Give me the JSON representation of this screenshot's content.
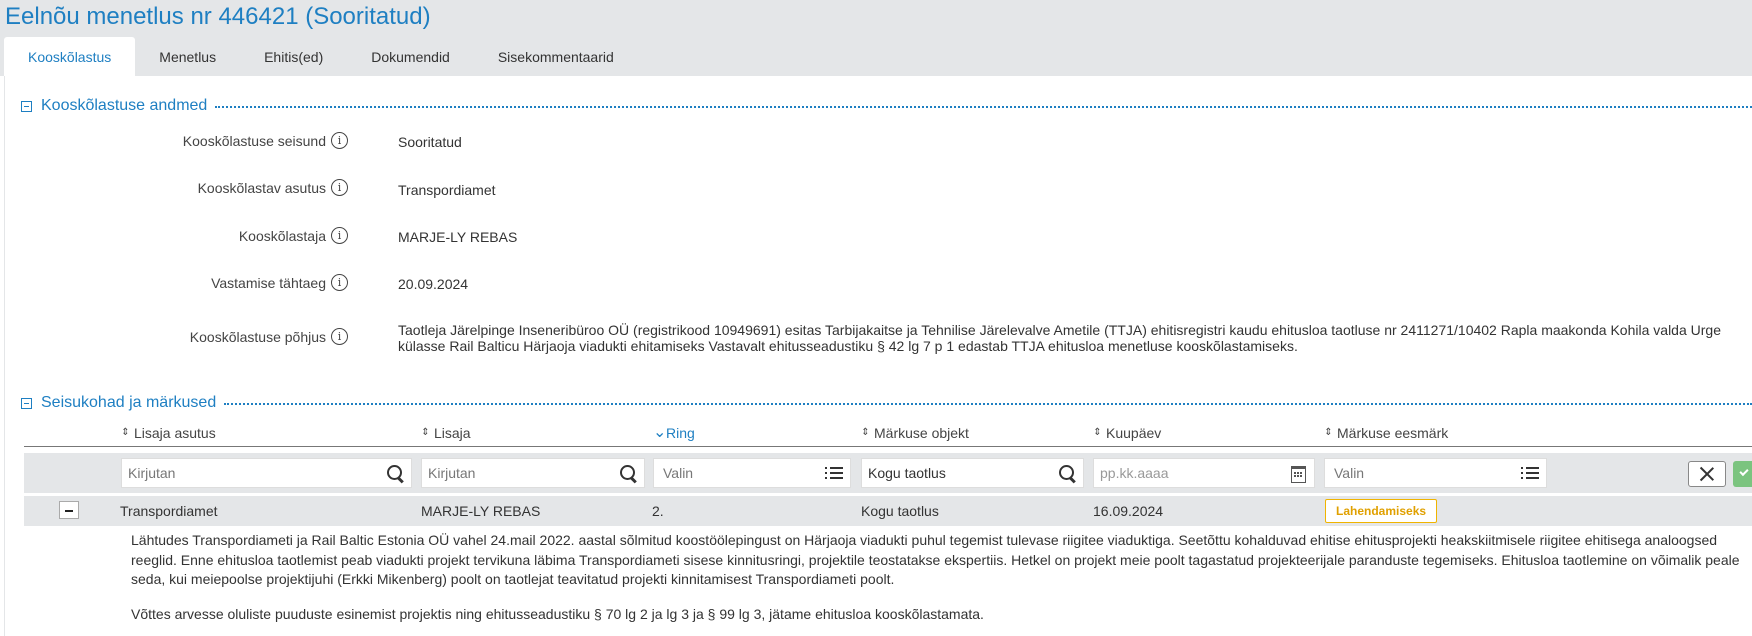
{
  "header": {
    "title": "Eelnõu menetlus nr 446421 (Sooritatud)"
  },
  "tabs": [
    {
      "label": "Kooskõlastus",
      "active": true
    },
    {
      "label": "Menetlus"
    },
    {
      "label": "Ehitis(ed)"
    },
    {
      "label": "Dokumendid"
    },
    {
      "label": "Sisekommentaarid"
    }
  ],
  "details": {
    "section_title": "Kooskõlastuse andmed",
    "rows": [
      {
        "label": "Kooskõlastuse seisund",
        "value": "Sooritatud"
      },
      {
        "label": "Kooskõlastav asutus",
        "value": "Transpordiamet"
      },
      {
        "label": "Kooskõlastaja",
        "value": "MARJE-LY REBAS"
      },
      {
        "label": "Vastamise tähtaeg",
        "value": "20.09.2024"
      },
      {
        "label": "Kooskõlastuse põhjus",
        "value": "Taotleja Järelpinge Inseneribüroo OÜ (registrikood 10949691) esitas Tarbijakaitse ja Tehnilise Järelevalve Ametile (TTJA) ehitisregistri kaudu ehitusloa taotluse nr 2411271/10402 Rapla maakonda Kohila valda Urge külasse Rail Balticu Härjaoja viadukti ehitamiseks Vastavalt ehitusseadustiku § 42 lg 7 p 1 edastab TTJA ehitusloa menetluse kooskõlastamiseks."
      }
    ],
    "info_glyph": "i"
  },
  "remarks": {
    "section_title": "Seisukohad ja märkused",
    "columns": [
      {
        "label": "Lisaja asutus",
        "sort_icon": "⇕"
      },
      {
        "label": "Lisaja",
        "sort_icon": "⇕"
      },
      {
        "label": "Ring",
        "sort_icon": "⌄",
        "sorted": true
      },
      {
        "label": "Märkuse objekt",
        "sort_icon": "⇕"
      },
      {
        "label": "Kuupäev",
        "sort_icon": "⇕"
      },
      {
        "label": "Märkuse eesmärk",
        "sort_icon": "⇕"
      }
    ],
    "filters": [
      {
        "placeholder": "Kirjutan",
        "icon": "search-icon"
      },
      {
        "placeholder": "Kirjutan",
        "icon": "search-icon"
      },
      {
        "placeholder": "Valin",
        "icon": "list-icon"
      },
      {
        "value": "Kogu taotlus",
        "icon": "search-icon"
      },
      {
        "placeholder": "pp.kk.aaaa",
        "icon": "calendar-icon"
      },
      {
        "placeholder": "Valin",
        "icon": "list-icon"
      }
    ],
    "rows": [
      {
        "agency": "Transpordiamet",
        "author": "MARJE-LY REBAS",
        "round": "2.",
        "object": "Kogu taotlus",
        "date": "16.09.2024",
        "purpose": "Lahendamiseks",
        "comment_1": "Lähtudes Transpordiameti ja Rail Baltic Estonia OÜ vahel 24.mail 2022. aastal sõlmitud koostöölepingust on Härjaoja viadukti puhul tegemist tulevase riigitee viaduktiga. Seetõttu kohalduvad ehitise ehitusprojekti heakskiitmisele riigitee ehitisega analoogsed reeglid. Enne ehitusloa taotlemist peab viadukti projekt tervikuna läbima Transpordiameti sisese kinnitusringi, projektile teostatakse ekspertiis. Hetkel on projekt meie poolt tagastatud projekteerijale paranduste tegemiseks. Ehitusloa taotlemine on võimalik peale seda, kui meiepoolse projektijuhi (Erkki Mikenberg) poolt on taotlejat teavitatud projekti kinnitamisest Transpordiameti poolt.",
        "comment_2": "Võttes arvesse oluliste puuduste esinemist projektis ning ehitusseadustiku § 70 lg 2 ja lg 3 ja § 99 lg 3, jätame ehitusloa kooskõlastamata."
      }
    ]
  },
  "colors": {
    "accent": "#1e7fc2",
    "badge": "#f0b400",
    "confirm": "#7bc47f",
    "band": "#e4e6e8"
  }
}
